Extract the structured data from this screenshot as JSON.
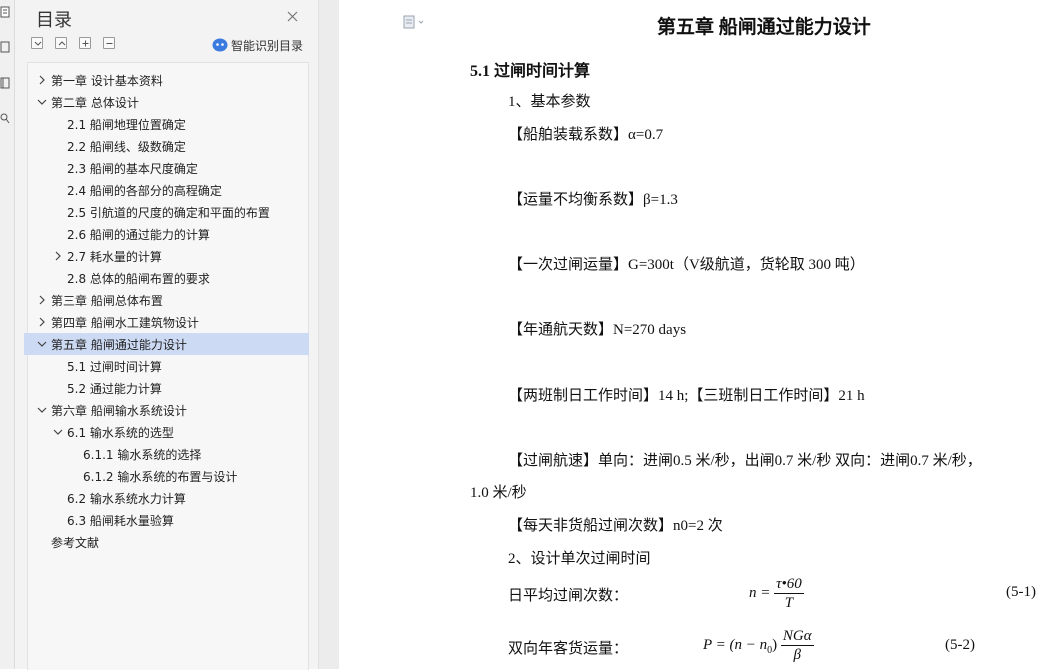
{
  "nav": {
    "title": "目录",
    "smart_label": "智能识别目录",
    "items": [
      {
        "label": "第一章  设计基本资料",
        "level": 0,
        "expander": "collapsed"
      },
      {
        "label": "第二章  总体设计",
        "level": 0,
        "expander": "expanded"
      },
      {
        "label": "2.1  船闸地理位置确定",
        "level": 1,
        "expander": "none"
      },
      {
        "label": "2.2  船闸线、级数确定",
        "level": 1,
        "expander": "none"
      },
      {
        "label": "2.3  船闸的基本尺度确定",
        "level": 1,
        "expander": "none"
      },
      {
        "label": "2.4  船闸的各部分的高程确定",
        "level": 1,
        "expander": "none"
      },
      {
        "label": "2.5  引航道的尺度的确定和平面的布置",
        "level": 1,
        "expander": "none"
      },
      {
        "label": "2.6  船闸的通过能力的计算",
        "level": 1,
        "expander": "none"
      },
      {
        "label": "2.7  耗水量的计算",
        "level": 1,
        "expander": "collapsed"
      },
      {
        "label": "2.8  总体的船闸布置的要求",
        "level": 1,
        "expander": "none"
      },
      {
        "label": "第三章  船闸总体布置",
        "level": 0,
        "expander": "collapsed"
      },
      {
        "label": "第四章  船闸水工建筑物设计",
        "level": 0,
        "expander": "collapsed"
      },
      {
        "label": "第五章  船闸通过能力设计",
        "level": 0,
        "expander": "expanded",
        "active": true
      },
      {
        "label": "5.1 过闸时间计算",
        "level": 1,
        "expander": "none"
      },
      {
        "label": "5.2 通过能力计算",
        "level": 1,
        "expander": "none"
      },
      {
        "label": "第六章  船闸输水系统设计",
        "level": 0,
        "expander": "expanded"
      },
      {
        "label": "6.1 输水系统的选型",
        "level": 1,
        "expander": "expanded"
      },
      {
        "label": "6.1.1 输水系统的选择",
        "level": 2,
        "expander": "none"
      },
      {
        "label": "6.1.2 输水系统的布置与设计",
        "level": 2,
        "expander": "none"
      },
      {
        "label": "6.2 输水系统水力计算",
        "level": 1,
        "expander": "none"
      },
      {
        "label": "6.3 船闸耗水量验算",
        "level": 1,
        "expander": "none"
      },
      {
        "label": "参考文献",
        "level": 0,
        "expander": "none"
      }
    ]
  },
  "doc": {
    "chapter_title": "第五章  船闸通过能力设计",
    "section_title": "5.1 过闸时间计算",
    "p_basic": "1、基本参数",
    "p_alpha": "【船舶装载系数】α=0.7",
    "p_beta": "【运量不均衡系数】β=1.3",
    "p_g": "【一次过闸运量】G=300t（V级航道，货轮取 300 吨）",
    "p_n": "【年通航天数】N=270 days",
    "p_shift": "【两班制日工作时间】14 h;【三班制日工作时间】21 h",
    "p_speed": "【过闸航速】单向：进闸0.5  米/秒，出闸0.7  米/秒  双向：进闸0.7  米/秒，",
    "p_speed2": "1.0  米/秒",
    "p_n0": "【每天非货船过闸次数】n0=2  次",
    "p_design": "2、设计单次过闸时间",
    "eq1_label": "日平均过闸次数：",
    "eq1_lhs": "n =",
    "eq1_num": "τ•60",
    "eq1_den": "T",
    "eq1_no": "(5-1)",
    "eq2_label": "双向年客货运量：",
    "eq2_lhs": "P = (n − n",
    "eq2_sub": "0",
    "eq2_close": ")",
    "eq2_num": "NGα",
    "eq2_den": "β",
    "eq2_no": "(5-2)"
  },
  "colors": {
    "active_bg": "#cddaf3",
    "nav_bg": "#f3f3f3",
    "accent": "#3b7be0"
  }
}
